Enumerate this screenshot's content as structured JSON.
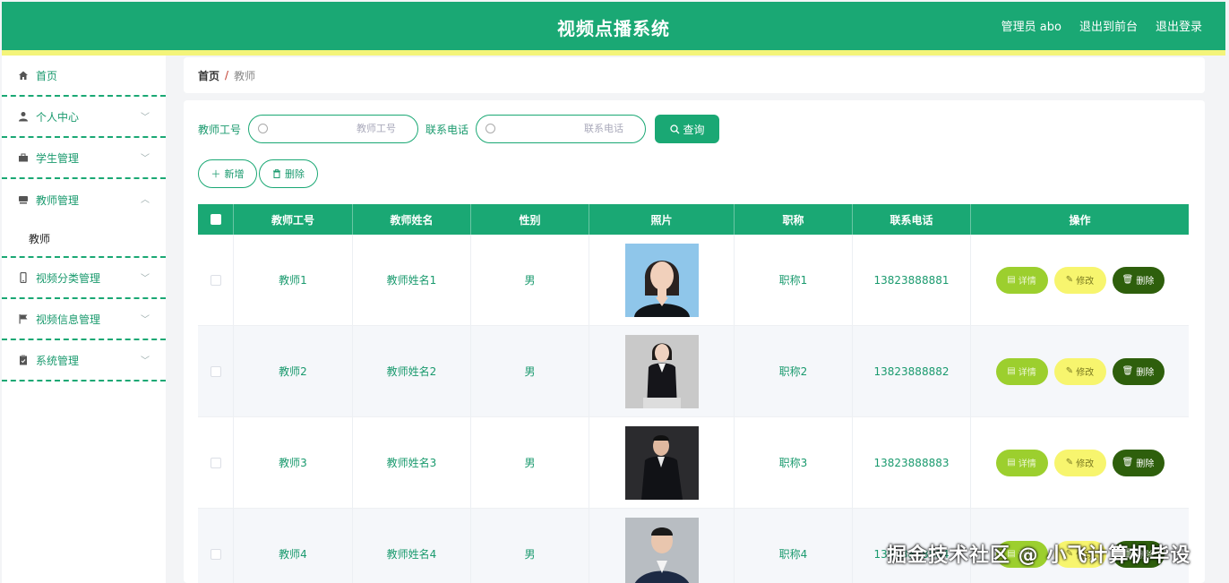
{
  "header": {
    "title": "视频点播系统",
    "user": "管理员 abo",
    "to_front": "退出到前台",
    "logout": "退出登录"
  },
  "sidebar": {
    "items": [
      {
        "label": "首页",
        "icon": "home-icon"
      },
      {
        "label": "个人中心",
        "icon": "user-icon"
      },
      {
        "label": "学生管理",
        "icon": "briefcase-icon"
      },
      {
        "label": "教师管理",
        "icon": "drive-icon"
      },
      {
        "label": "视频分类管理",
        "icon": "phone-icon"
      },
      {
        "label": "视频信息管理",
        "icon": "flag-icon"
      },
      {
        "label": "系统管理",
        "icon": "clipboard-icon"
      }
    ],
    "submenu_teacher": "教师"
  },
  "breadcrumb": {
    "home": "首页",
    "sep": "/",
    "current": "教师"
  },
  "search": {
    "id_label": "教师工号",
    "id_placeholder": "教师工号",
    "phone_label": "联系电话",
    "phone_placeholder": "联系电话",
    "query_label": "查询"
  },
  "actions": {
    "add_label": "新增",
    "delete_label": "删除"
  },
  "table": {
    "columns": [
      "教师工号",
      "教师姓名",
      "性别",
      "照片",
      "职称",
      "联系电话",
      "操作"
    ],
    "rows": [
      {
        "id": "教师1",
        "name": "教师姓名1",
        "gender": "男",
        "title": "职称1",
        "phone": "13823888881"
      },
      {
        "id": "教师2",
        "name": "教师姓名2",
        "gender": "男",
        "title": "职称2",
        "phone": "13823888882"
      },
      {
        "id": "教师3",
        "name": "教师姓名3",
        "gender": "男",
        "title": "职称3",
        "phone": "13823888883"
      },
      {
        "id": "教师4",
        "name": "教师姓名4",
        "gender": "男",
        "title": "职称4",
        "phone": "13823888884"
      }
    ],
    "op_detail": "详情",
    "op_edit": "修改",
    "op_delete": "删除"
  },
  "watermark": "掘金技术社区 @ 小飞计算机毕设",
  "colors": {
    "primary": "#1aa874",
    "accent_bar": "#f4f47a",
    "detail": "#9ccf2e",
    "edit": "#f7f56e",
    "delete": "#2e5f0c"
  }
}
